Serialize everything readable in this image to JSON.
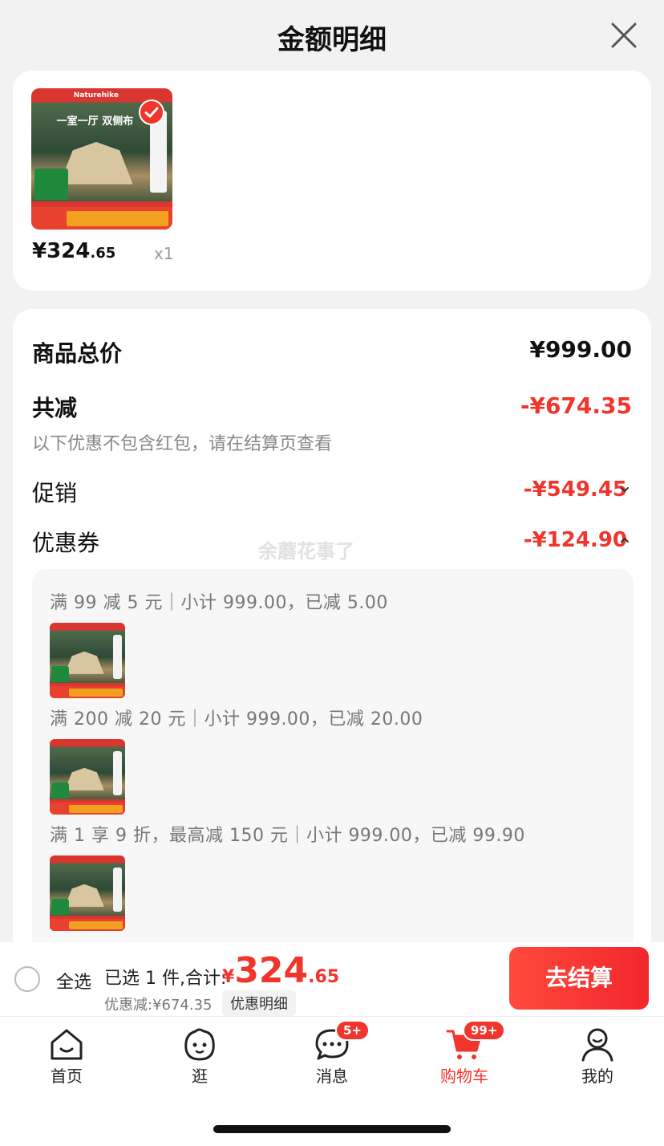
{
  "header": {
    "title": "金额明细"
  },
  "product": {
    "thumb_brand": "Naturehike",
    "thumb_headline": "一室一厅 双侧布",
    "price_int": "¥324",
    "price_dec": ".65",
    "qty": "x1"
  },
  "detail": {
    "total_label": "商品总价",
    "total_value": "¥999.00",
    "reduce_label": "共减",
    "reduce_value": "-¥674.35",
    "note": "以下优惠不包含红包，请在结算页查看",
    "promo_label": "促销",
    "promo_value": "-¥549.45",
    "coupon_label": "优惠券",
    "coupon_value": "-¥124.90",
    "watermark": "余蘑花事了"
  },
  "coupons": [
    "满 99 减 5 元｜小计 999.00，已减 5.00",
    "满 200 减 20 元｜小计 999.00，已减 20.00",
    "满 1 享 9 折，最高减 150 元｜小计 999.00，已减 99.90"
  ],
  "checkout": {
    "select_all": "全选",
    "selected": "已选 1 件,合计:",
    "yen": "¥",
    "total_int": "324",
    "total_dec": ".65",
    "discount": "优惠减:¥674.35",
    "detail_link": "优惠明细",
    "pay": "去结算"
  },
  "tabs": [
    {
      "label": "首页",
      "icon": "home-icon"
    },
    {
      "label": "逛",
      "icon": "face-icon"
    },
    {
      "label": "消息",
      "icon": "chat-icon",
      "badge": "5+"
    },
    {
      "label": "购物车",
      "icon": "cart-icon",
      "badge": "99+"
    },
    {
      "label": "我的",
      "icon": "user-icon"
    }
  ],
  "colors": {
    "accent": "#f0352c"
  }
}
